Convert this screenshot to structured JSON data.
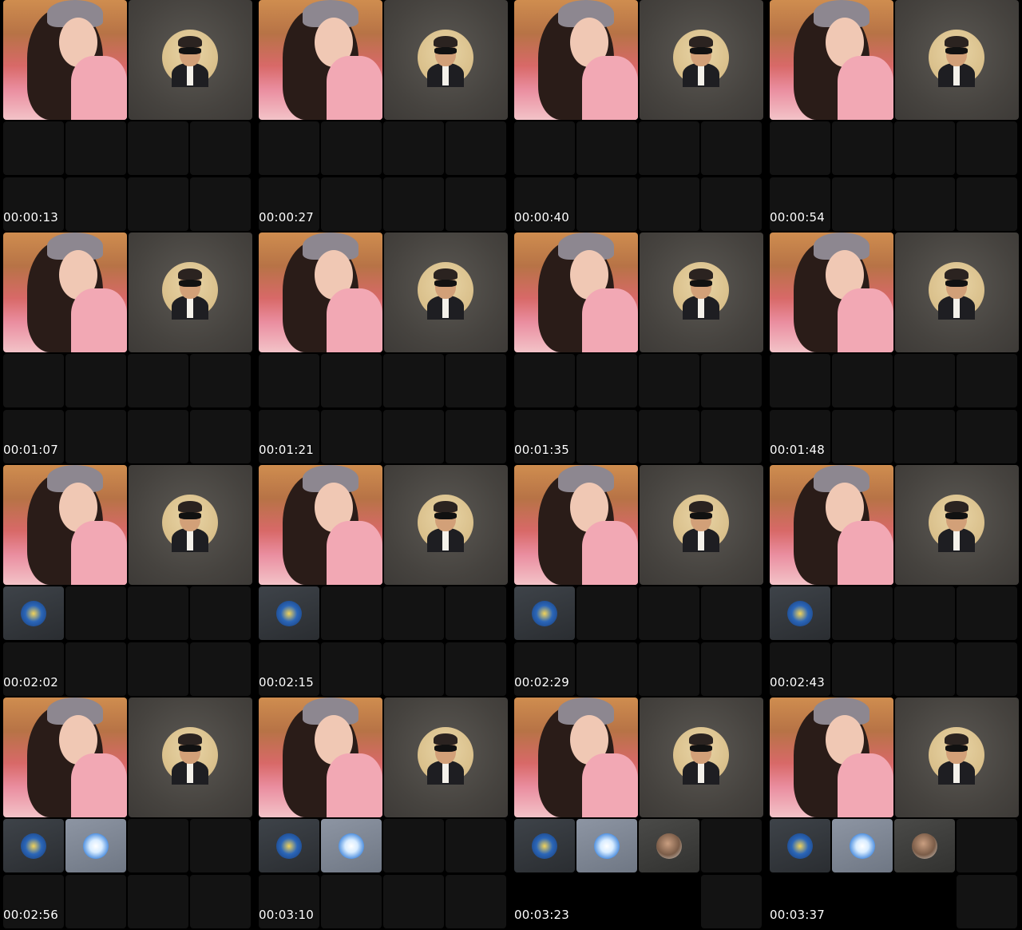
{
  "title": "",
  "frames": [
    {
      "timestamp": "00:00:13",
      "guests": []
    },
    {
      "timestamp": "00:00:27",
      "guests": []
    },
    {
      "timestamp": "00:00:40",
      "guests": []
    },
    {
      "timestamp": "00:00:54",
      "guests": []
    },
    {
      "timestamp": "00:01:07",
      "guests": []
    },
    {
      "timestamp": "00:01:21",
      "guests": []
    },
    {
      "timestamp": "00:01:35",
      "guests": []
    },
    {
      "timestamp": "00:01:48",
      "guests": []
    },
    {
      "timestamp": "00:02:02",
      "guests": [
        "team-logo-badge"
      ]
    },
    {
      "timestamp": "00:02:15",
      "guests": [
        "team-logo-badge"
      ]
    },
    {
      "timestamp": "00:02:29",
      "guests": [
        "team-logo-badge"
      ]
    },
    {
      "timestamp": "00:02:43",
      "guests": [
        "team-logo-badge"
      ]
    },
    {
      "timestamp": "00:02:56",
      "guests": [
        "team-logo-badge",
        "mascot-badge"
      ]
    },
    {
      "timestamp": "00:03:10",
      "guests": [
        "team-logo-badge",
        "mascot-badge"
      ]
    },
    {
      "timestamp": "00:03:23",
      "guests": [
        "team-logo-badge",
        "mascot-badge",
        "bearded-man-avatar"
      ]
    },
    {
      "timestamp": "00:03:37",
      "guests": [
        "team-logo-badge",
        "mascot-badge",
        "bearded-man-avatar"
      ]
    }
  ],
  "colors": {
    "background": "#000000",
    "empty_tile": "#131313",
    "host_tile": "#4a4743",
    "timestamp_text": "#ffffff"
  }
}
